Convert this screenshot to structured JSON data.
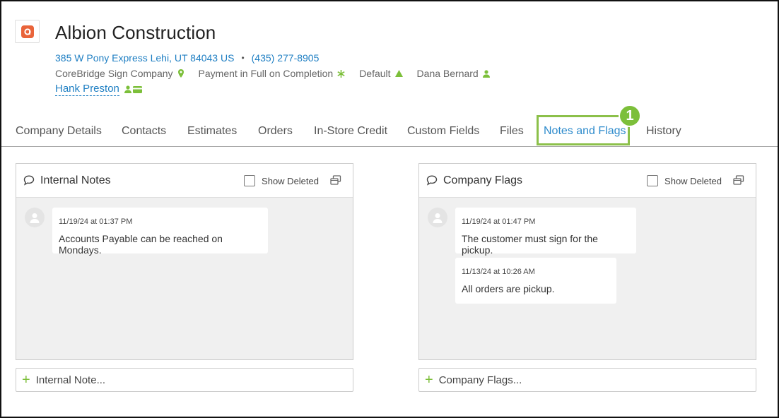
{
  "company": {
    "name": "Albion Construction",
    "address": "385 W Pony Express Lehi, UT 84043 US",
    "separator": "•",
    "phone": "(435) 277-8905",
    "location": "CoreBridge Sign Company",
    "payment_terms": "Payment in Full on Completion",
    "pricing": "Default",
    "salesperson": "Dana Bernard",
    "primary_contact": "Hank Preston",
    "logo_icon": "company-logo-icon"
  },
  "tabs": [
    {
      "label": "Company Details"
    },
    {
      "label": "Contacts"
    },
    {
      "label": "Estimates"
    },
    {
      "label": "Orders"
    },
    {
      "label": "In-Store Credit"
    },
    {
      "label": "Custom Fields"
    },
    {
      "label": "Files"
    },
    {
      "label": "Notes and Flags"
    },
    {
      "label": "History"
    }
  ],
  "callout": "1",
  "internal_notes": {
    "title": "Internal Notes",
    "show_deleted_label": "Show Deleted",
    "notes": [
      {
        "timestamp": "11/19/24 at 01:37 PM",
        "text": "Accounts Payable can be reached on Mondays."
      }
    ],
    "add_label": "Internal Note..."
  },
  "company_flags": {
    "title": "Company Flags",
    "show_deleted_label": "Show Deleted",
    "notes": [
      {
        "timestamp": "11/19/24 at 01:47 PM",
        "text": "The customer must sign for the pickup."
      },
      {
        "timestamp": "11/13/24 at 10:26 AM",
        "text": "All orders are pickup."
      }
    ],
    "add_label": "Company Flags..."
  },
  "colors": {
    "accent_green": "#7cbf3a",
    "link_blue": "#1f7fc3",
    "logo_orange": "#e9643a"
  }
}
